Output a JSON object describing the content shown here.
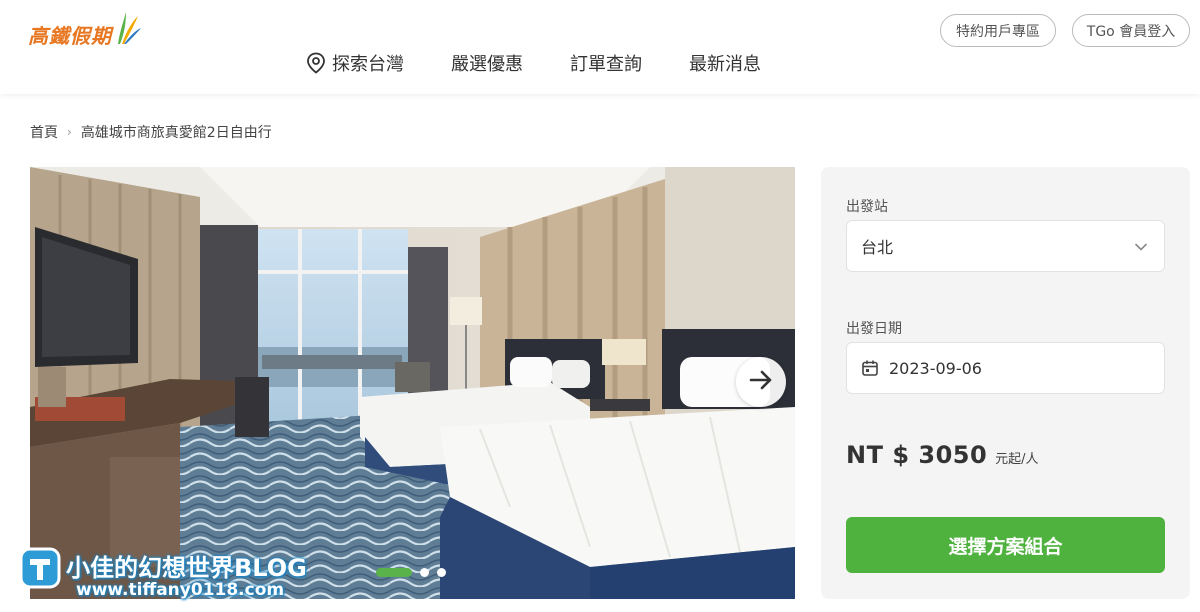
{
  "header": {
    "logo_text": "高鐵假期",
    "nav": [
      {
        "label": "探索台灣",
        "icon": "location-pin-icon"
      },
      {
        "label": "嚴選優惠"
      },
      {
        "label": "訂單查詢"
      },
      {
        "label": "最新消息"
      }
    ],
    "corp_button": "特約用戶專區",
    "login_button": "TGo 會員登入"
  },
  "breadcrumb": {
    "home": "首頁",
    "current": "高雄城市商旅真愛館2日自由行"
  },
  "gallery": {
    "slide_count": 3,
    "active_slide": 1,
    "next_icon": "arrow-right-icon"
  },
  "watermark": {
    "line1": "小佳的幻想世界BLOG",
    "line2": "www.tiffany0118.com"
  },
  "booking": {
    "departure_label": "出發站",
    "departure_value": "台北",
    "date_label": "出發日期",
    "date_value": "2023-09-06",
    "price": "NT $ 3050",
    "price_unit": "元起/人",
    "cta": "選擇方案組合"
  },
  "colors": {
    "brand_orange": "#e87722",
    "accent_green": "#4fb13e"
  }
}
